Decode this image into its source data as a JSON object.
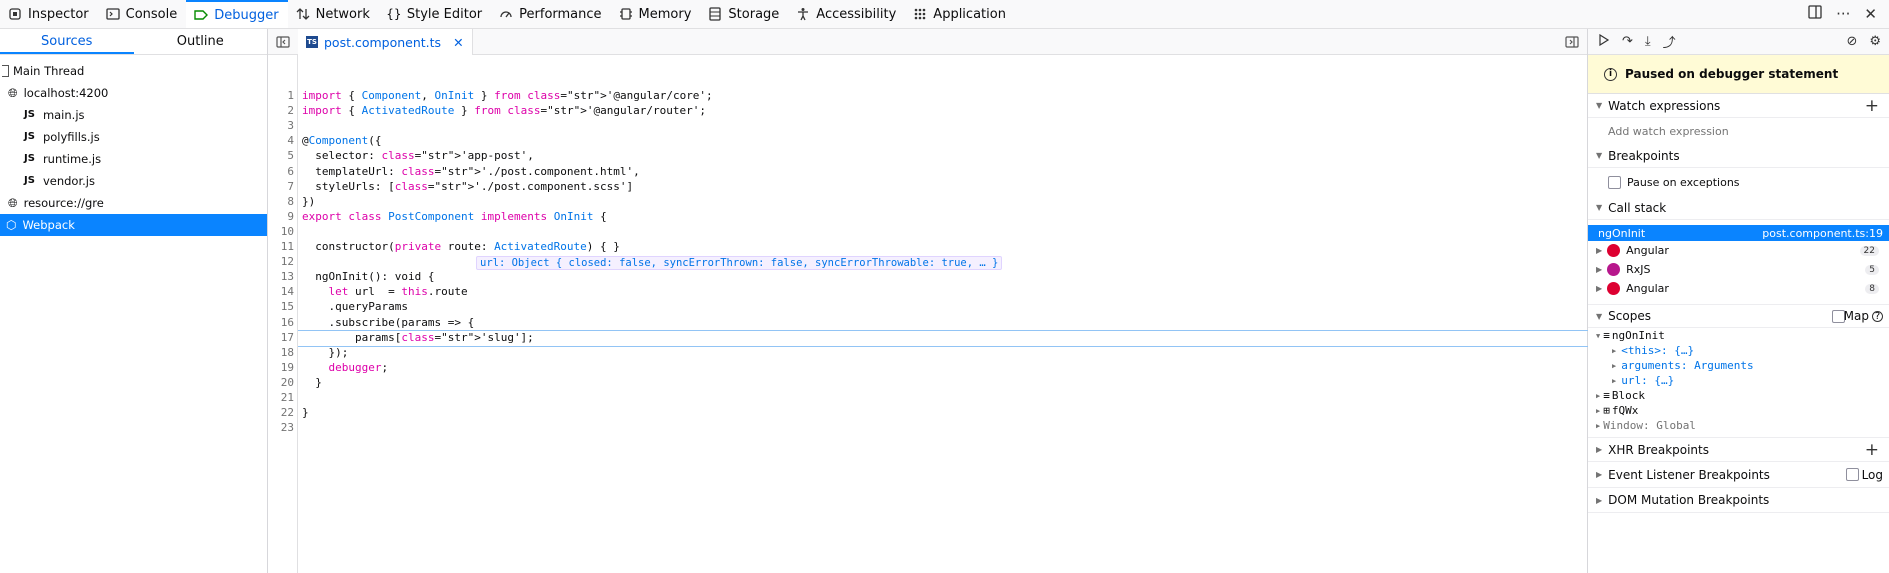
{
  "toolbar": {
    "tabs": [
      {
        "label": "Inspector",
        "icon": "inspector-icon"
      },
      {
        "label": "Console",
        "icon": "console-icon"
      },
      {
        "label": "Debugger",
        "icon": "debugger-icon",
        "active": true
      },
      {
        "label": "Network",
        "icon": "network-icon"
      },
      {
        "label": "Style Editor",
        "icon": "style-editor-icon"
      },
      {
        "label": "Performance",
        "icon": "performance-icon"
      },
      {
        "label": "Memory",
        "icon": "memory-icon"
      },
      {
        "label": "Storage",
        "icon": "storage-icon"
      },
      {
        "label": "Accessibility",
        "icon": "accessibility-icon"
      },
      {
        "label": "Application",
        "icon": "application-icon"
      }
    ],
    "more": "···"
  },
  "sources": {
    "tabs": [
      "Sources",
      "Outline"
    ],
    "tree": [
      {
        "label": "Main Thread"
      },
      {
        "label": "localhost:4200"
      },
      {
        "label": "main.js",
        "badge": "JS"
      },
      {
        "label": "polyfills.js",
        "badge": "JS"
      },
      {
        "label": "runtime.js",
        "badge": "JS"
      },
      {
        "label": "vendor.js",
        "badge": "JS"
      },
      {
        "label": "resource://gre"
      },
      {
        "label": "Webpack"
      }
    ]
  },
  "editor": {
    "file_tab": "post.component.ts",
    "ts_badge": "TS",
    "inline_preview": "url: Object { closed: false, syncErrorThrown: false, syncErrorThrowable: true, … }",
    "lines": [
      "import { Component, OnInit } from '@angular/core';",
      "import { ActivatedRoute } from '@angular/router';",
      "",
      "@Component({",
      "  selector: 'app-post',",
      "  templateUrl: './post.component.html',",
      "  styleUrls: ['./post.component.scss']",
      "})",
      "export class PostComponent implements OnInit {",
      "",
      "  constructor(private route: ActivatedRoute) { }",
      "",
      "  ngOnInit(): void {",
      "    let url  = this.route ",
      "    .queryParams",
      "    .subscribe(params => {",
      "        params['slug'];",
      "    });",
      "    debugger;",
      "  }",
      "",
      "}",
      ""
    ]
  },
  "right": {
    "paused": "Paused on debugger statement",
    "watch": {
      "title": "Watch expressions",
      "placeholder": "Add watch expression"
    },
    "breakpoints": {
      "title": "Breakpoints",
      "pause_exceptions": "Pause on exceptions"
    },
    "call_stack": {
      "title": "Call stack",
      "selected": {
        "name": "ngOnInit",
        "location": "post.component.ts:19"
      },
      "groups": [
        {
          "name": "Angular",
          "count": "22",
          "color": "#dd0031"
        },
        {
          "name": "RxJS",
          "count": "5",
          "color": "#b7178c"
        },
        {
          "name": "Angular",
          "count": "8",
          "color": "#dd0031"
        }
      ]
    },
    "scopes": {
      "title": "Scopes",
      "map_label": "Map",
      "root": "ngOnInit",
      "items": [
        "<this>: {…}",
        "arguments: Arguments",
        "url: {…}"
      ],
      "others": [
        "Block",
        "fQWx",
        "Window: Global"
      ]
    },
    "xhr": "XHR Breakpoints",
    "event_listener": {
      "title": "Event Listener Breakpoints",
      "log": "Log"
    },
    "dom_mutation": "DOM Mutation Breakpoints"
  }
}
